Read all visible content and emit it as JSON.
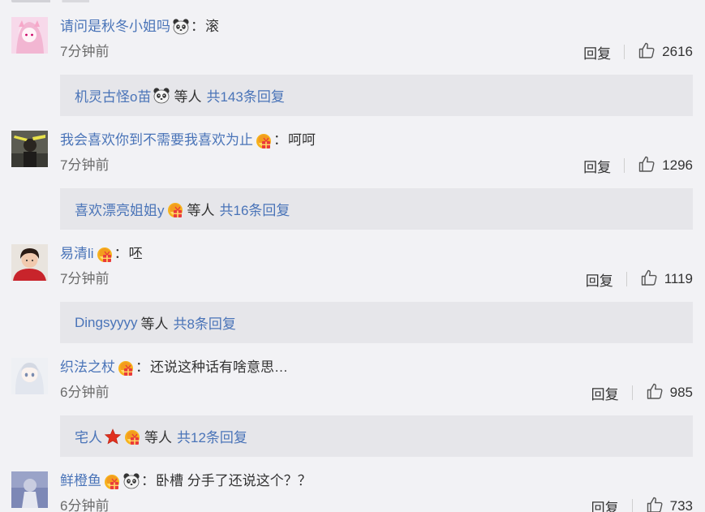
{
  "comments": [
    {
      "user": "请问是秋冬小姐吗",
      "badges": [
        "panda-icon"
      ],
      "text": "滚",
      "time": "7分钟前",
      "reply_label": "回复",
      "likes": "2616",
      "replies": {
        "names": "机灵古怪o苗",
        "badges": [
          "panda-icon"
        ],
        "etc": "等人",
        "total": "共143条回复"
      }
    },
    {
      "user": "我会喜欢你到不需要我喜欢为止",
      "badges": [
        "gift-badge-icon"
      ],
      "text": "呵呵",
      "time": "7分钟前",
      "reply_label": "回复",
      "likes": "1296",
      "replies": {
        "names": "喜欢漂亮姐姐y",
        "badges": [
          "gift-badge-icon"
        ],
        "etc": "等人",
        "total": "共16条回复"
      }
    },
    {
      "user": "易清li",
      "badges": [
        "gift-badge-icon"
      ],
      "text": "呸",
      "time": "7分钟前",
      "reply_label": "回复",
      "likes": "1119",
      "replies": {
        "names": "Dingsyyyy",
        "badges": [],
        "etc": "等人",
        "total": "共8条回复"
      }
    },
    {
      "user": "织法之杖",
      "badges": [
        "gift-badge-icon"
      ],
      "text": "还说这种话有啥意思…",
      "time": "6分钟前",
      "reply_label": "回复",
      "likes": "985",
      "replies": {
        "names": "宅人",
        "badges": [
          "red-star-icon",
          "gift-badge-icon"
        ],
        "etc": "等人",
        "total": "共12条回复"
      }
    },
    {
      "user": "鲜橙鱼",
      "badges": [
        "gift-badge-icon",
        "panda-icon"
      ],
      "text": "卧槽 分手了还说这个？？",
      "time": "6分钟前",
      "reply_label": "回复",
      "likes": "733"
    }
  ],
  "colors": {
    "link": "#4a74b8",
    "text": "#333333",
    "muted": "#6b6b6b",
    "page_bg": "#f2f2f5",
    "reply_bg": "#e6e6ea"
  }
}
